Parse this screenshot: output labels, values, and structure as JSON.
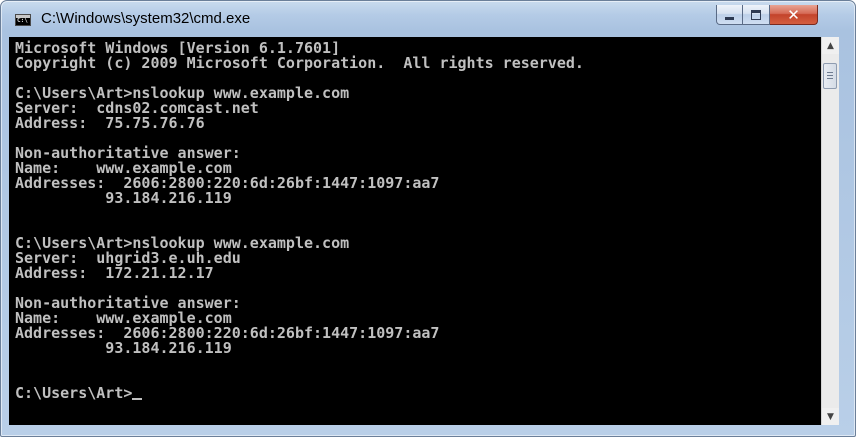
{
  "window": {
    "title": "C:\\Windows\\system32\\cmd.exe",
    "icon": "cmd-icon",
    "icon_text": "C:\\",
    "controls": {
      "minimize_icon": "minimize-icon",
      "maximize_icon": "maximize-icon",
      "close_icon": "close-icon",
      "close_glyph": "✕"
    }
  },
  "console": {
    "lines": [
      "Microsoft Windows [Version 6.1.7601]",
      "Copyright (c) 2009 Microsoft Corporation.  All rights reserved.",
      "",
      "C:\\Users\\Art>nslookup www.example.com",
      "Server:  cdns02.comcast.net",
      "Address:  75.75.76.76",
      "",
      "Non-authoritative answer:",
      "Name:    www.example.com",
      "Addresses:  2606:2800:220:6d:26bf:1447:1097:aa7",
      "          93.184.216.119",
      "",
      "",
      "C:\\Users\\Art>nslookup www.example.com",
      "Server:  uhgrid3.e.uh.edu",
      "Address:  172.21.12.17",
      "",
      "Non-authoritative answer:",
      "Name:    www.example.com",
      "Addresses:  2606:2800:220:6d:26bf:1447:1097:aa7",
      "          93.184.216.119",
      "",
      "",
      "C:\\Users\\Art>"
    ],
    "text_color": "#c0c0c0",
    "background": "#000000"
  },
  "scrollbar": {
    "up_glyph": "▲",
    "down_glyph": "▼"
  }
}
